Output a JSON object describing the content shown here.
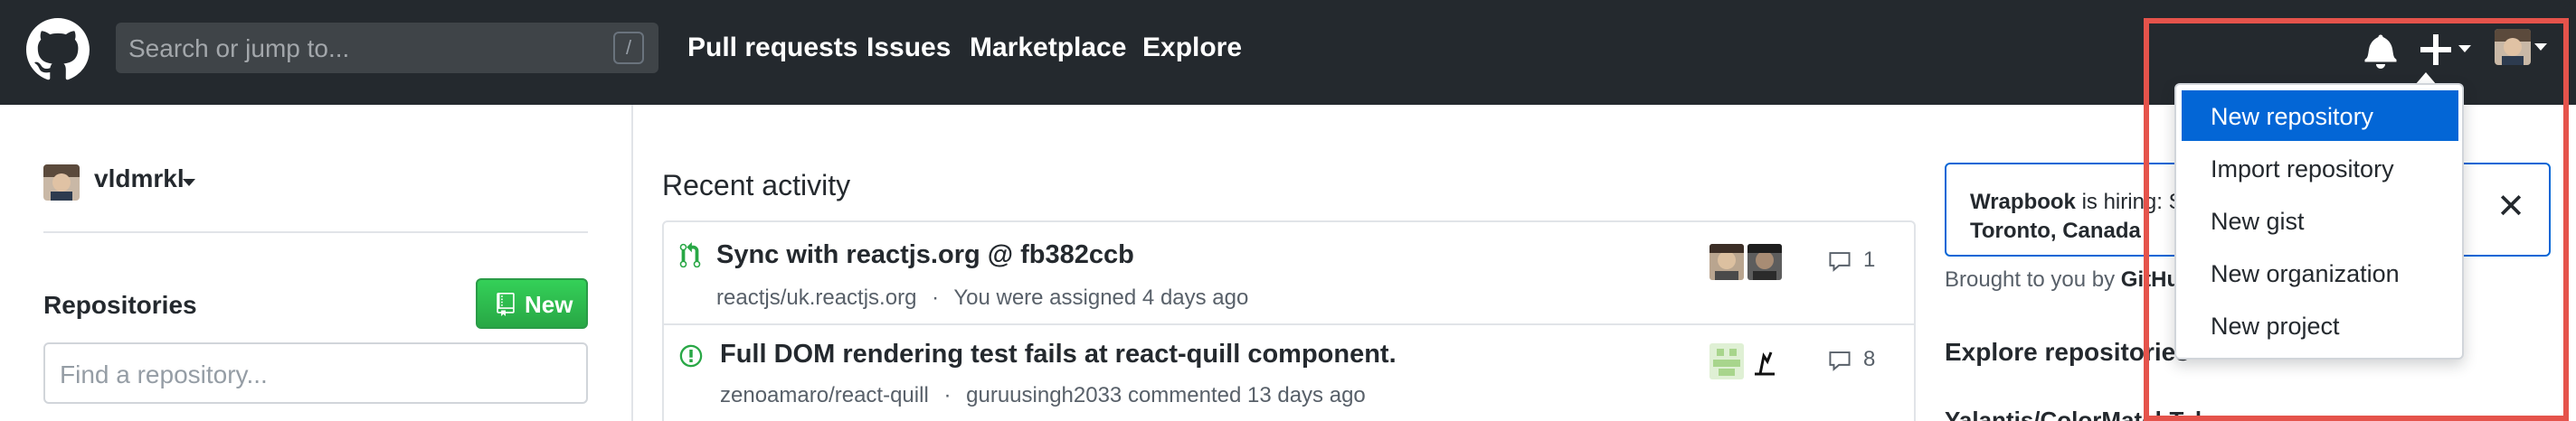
{
  "header": {
    "search_placeholder": "Search or jump to...",
    "search_shortcut": "/",
    "nav": [
      "Pull requests",
      "Issues",
      "Marketplace",
      "Explore"
    ],
    "icons": [
      "github-logo",
      "bell-icon",
      "plus-icon",
      "avatar"
    ]
  },
  "dropdown": {
    "items": [
      "New repository",
      "Import repository",
      "New gist",
      "New organization",
      "New project"
    ],
    "active_index": 0
  },
  "sidebar": {
    "username": "vldmrkl",
    "repos_title": "Repositories",
    "new_button": "New",
    "find_placeholder": "Find a repository..."
  },
  "feed": {
    "title": "Recent activity",
    "items": [
      {
        "title": "Sync with reactjs.org @ fb382ccb",
        "repo": "reactjs/uk.reactjs.org",
        "sep": "·",
        "meta": "You were assigned 4 days ago",
        "comments": "1",
        "icon": "pull-request-icon"
      },
      {
        "title": "Full DOM rendering test fails at react-quill component.",
        "repo": "zenoamaro/react-quill",
        "sep": "·",
        "meta": "guruusingh2033 commented 13 days ago",
        "comments": "8",
        "icon": "issue-opened-icon"
      }
    ]
  },
  "right": {
    "promo_company": "Wrapbook",
    "promo_text": " is hiring: S",
    "promo_location": "Toronto, Canada",
    "brought_by": "Brought to you by ",
    "brought_brand": "GitHu",
    "explore_title": "Explore repositories",
    "explore_first": "Yalantis/ColorMatchTabs"
  },
  "colors": {
    "header_bg": "#24292e",
    "accent_blue": "#0366d6",
    "new_button_green": "#28a745",
    "highlight_red": "#e5534b"
  }
}
